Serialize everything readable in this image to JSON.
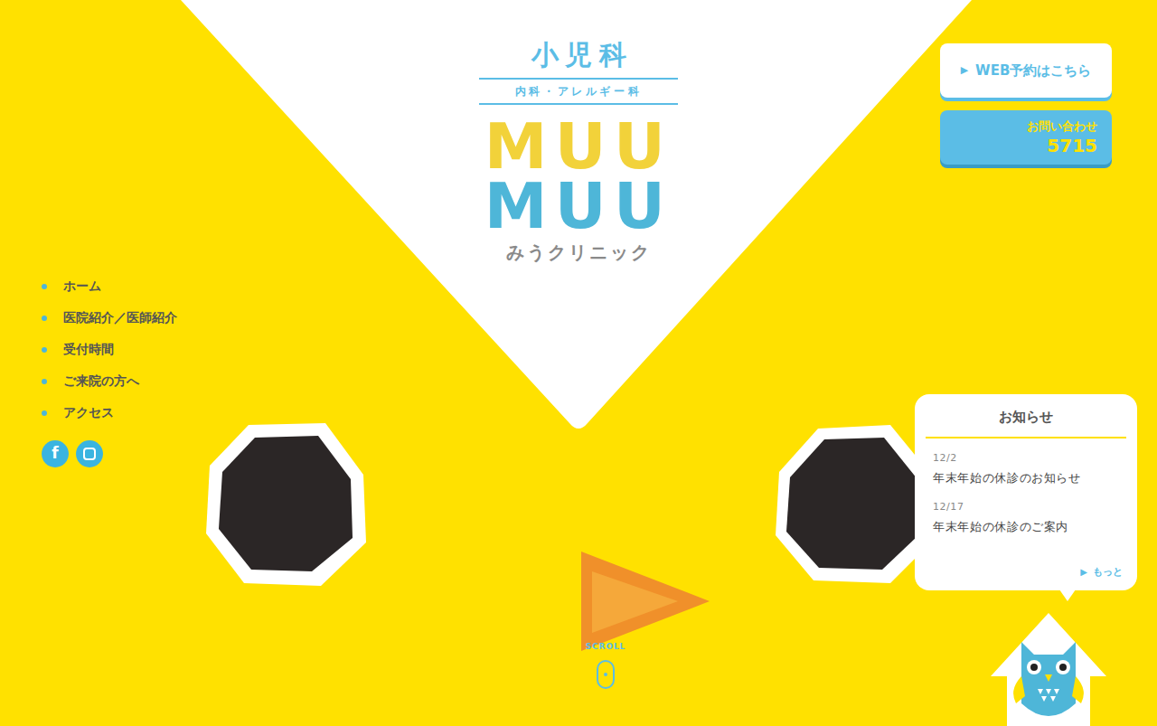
{
  "header": {
    "category": "小児科",
    "subcategory": "内科・アレルギー科",
    "logo_lines": [
      "MUU",
      "MUU"
    ],
    "clinic_name": "みうクリニック"
  },
  "nav": {
    "items": [
      {
        "label": "ホーム"
      },
      {
        "label": "医院紹介／医師紹介"
      },
      {
        "label": "受付時間"
      },
      {
        "label": "ご来院の方へ"
      },
      {
        "label": "アクセス"
      }
    ],
    "social": [
      "f"
    ]
  },
  "actions": {
    "reserve": {
      "icon": "▶",
      "label": "WEB予約はこちら"
    },
    "contact": {
      "label": "お問い合わせ",
      "phone": "5715"
    }
  },
  "news": {
    "title": "お知らせ",
    "items": [
      {
        "date": "12/2",
        "title": "年末年始の休診のお知らせ"
      },
      {
        "date": "12/17",
        "title": "年末年始の休診のご案内"
      }
    ],
    "more": {
      "icon": "▶",
      "label": "もっと"
    }
  },
  "scroll": {
    "label": "SCROLL"
  }
}
